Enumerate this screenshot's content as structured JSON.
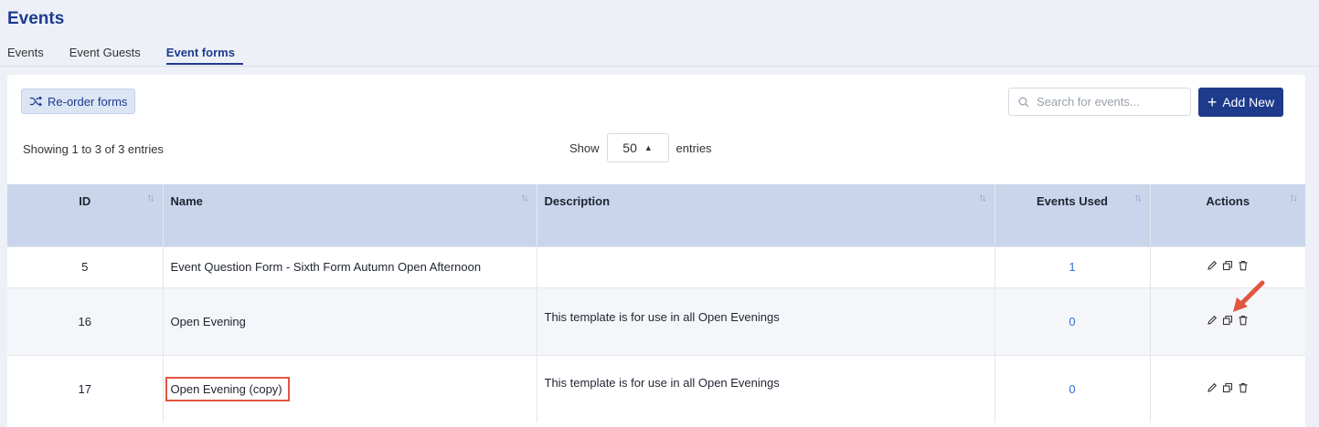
{
  "page": {
    "title": "Events",
    "tabs": [
      {
        "label": "Events",
        "active": false
      },
      {
        "label": "Event Guests",
        "active": false
      },
      {
        "label": "Event forms",
        "active": true
      }
    ]
  },
  "toolbar": {
    "reorder_label": "Re-order forms",
    "search_placeholder": "Search for events...",
    "add_label": "Add New"
  },
  "listing": {
    "info": "Showing 1 to 3 of 3 entries",
    "show_prefix": "Show",
    "page_size": "50",
    "show_suffix": "entries"
  },
  "table": {
    "columns": [
      "ID",
      "Name",
      "Description",
      "Events Used",
      "Actions"
    ],
    "rows": [
      {
        "id": "5",
        "name": "Event Question Form - Sixth Form Autumn Open Afternoon",
        "description": "",
        "events_used": "1"
      },
      {
        "id": "16",
        "name": "Open Evening",
        "description": "This template is for use in all Open Evenings",
        "events_used": "0"
      },
      {
        "id": "17",
        "name": "Open Evening (copy)",
        "description": "This template is for use in all Open Evenings",
        "events_used": "0"
      }
    ]
  },
  "colors": {
    "brand": "#1e3a8a",
    "header_bg": "#c9d5eb",
    "link": "#2f6fd8",
    "annotation": "#e2553f"
  }
}
